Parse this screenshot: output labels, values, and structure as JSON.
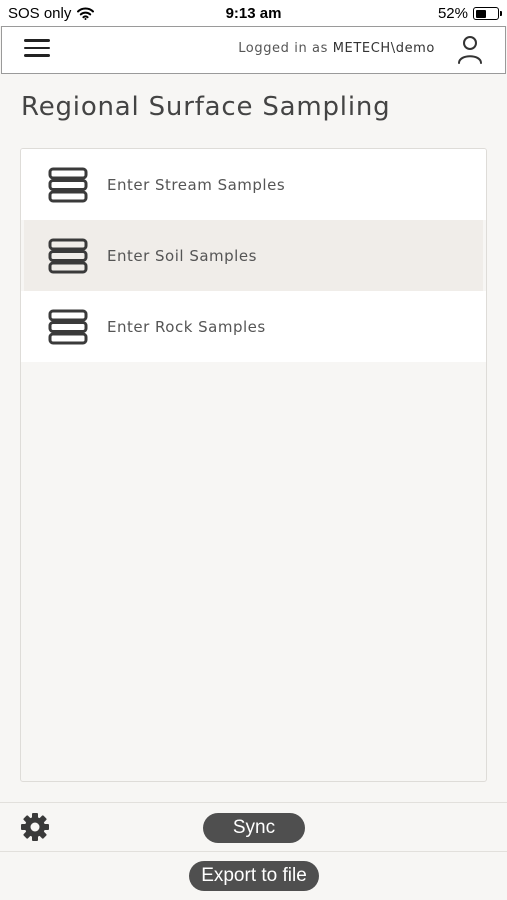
{
  "status_bar": {
    "carrier": "SOS only",
    "time": "9:13 am",
    "battery": "52%",
    "battery_level": 0.52
  },
  "header": {
    "logged_in_prefix": "Logged in as ",
    "username": "METECH\\demo"
  },
  "page": {
    "title": "Regional Surface Sampling"
  },
  "menu": {
    "items": [
      {
        "label": "Enter Stream Samples",
        "icon": "database-icon"
      },
      {
        "label": "Enter Soil Samples",
        "icon": "database-icon",
        "selected": true
      },
      {
        "label": "Enter Rock Samples",
        "icon": "database-icon"
      }
    ]
  },
  "footer": {
    "sync_label": "Sync",
    "export_label": "Export to file"
  },
  "colors": {
    "background": "#f7f6f4",
    "selected_row": "#f0ede9",
    "pill": "#4f4f4f"
  }
}
